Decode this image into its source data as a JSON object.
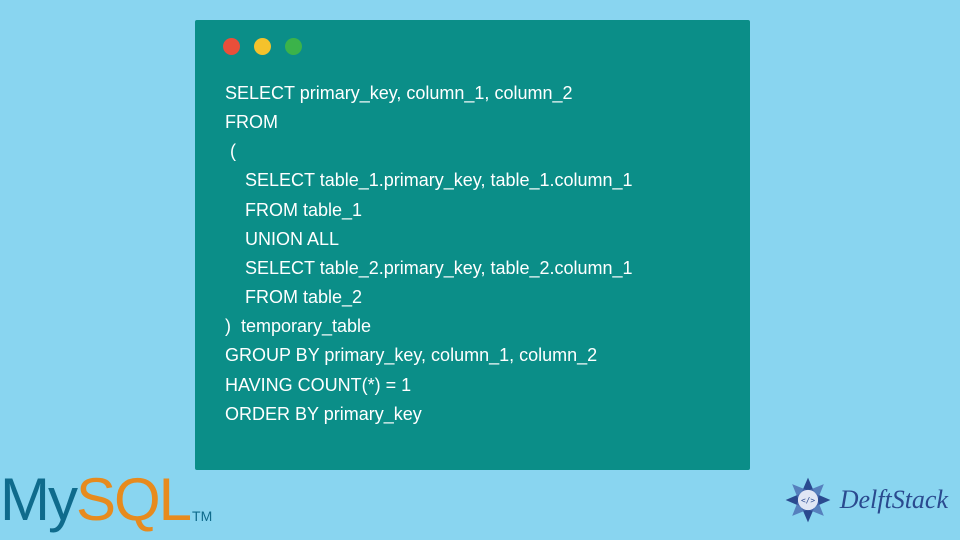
{
  "code": {
    "line1": "SELECT primary_key, column_1, column_2",
    "line2": "FROM",
    "line3": " (",
    "line4": "    SELECT table_1.primary_key, table_1.column_1",
    "line5": "    FROM table_1",
    "line6": "    UNION ALL",
    "line7": "    SELECT table_2.primary_key, table_2.column_1",
    "line8": "    FROM table_2",
    "line9": ")  temporary_table",
    "line10": "GROUP BY primary_key, column_1, column_2",
    "line11": "HAVING COUNT(*) = 1",
    "line12": "ORDER BY primary_key"
  },
  "logos": {
    "mysql_my": "My",
    "mysql_sql": "SQL",
    "mysql_tm": "TM",
    "delft": "DelftStack"
  }
}
